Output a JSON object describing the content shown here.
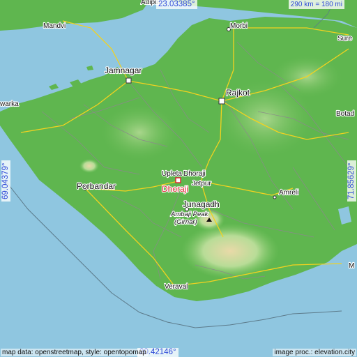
{
  "map": {
    "type": "topographic elevation map",
    "colors": {
      "sea": "#8fc6e0",
      "lowland": "#56b24a",
      "upland": "#a7d38a",
      "highland": "#ead6a3",
      "major_road": "#f3d21f",
      "minor_road": "#8a8a8a",
      "highlight": "#e0202e",
      "coord_text": "#2f4ad8"
    }
  },
  "places": {
    "adipur": "Adipur",
    "mandvi": "Mandvi",
    "morbi": "Morbi",
    "surendranagar": "Sure",
    "jamnagar": "Jamnagar",
    "rajkot": "Rajkot",
    "dwarka": "warka",
    "botad": "Botad",
    "upleta": "Upleta",
    "dhoraji_small": "Dhoraji",
    "jetpur": "Jetpur",
    "dhoraji": "Dhoraji",
    "porbandar": "Porbandar",
    "amreli": "Amreli",
    "junagadh": "Junagadh",
    "peak_name": "Ambaji Peak",
    "peak_sub": "(Girnar)",
    "veraval": "Veraval",
    "mahuva": "M"
  },
  "coords": {
    "top": "23.03385°",
    "bottom": "20.42146°",
    "left": "69.04379°",
    "right": "71.85629°"
  },
  "scale": "290 km = 180 mi",
  "credits": {
    "left": "map data: openstreetmap, style: opentopomap",
    "right": "image proc.: elevation.city"
  }
}
